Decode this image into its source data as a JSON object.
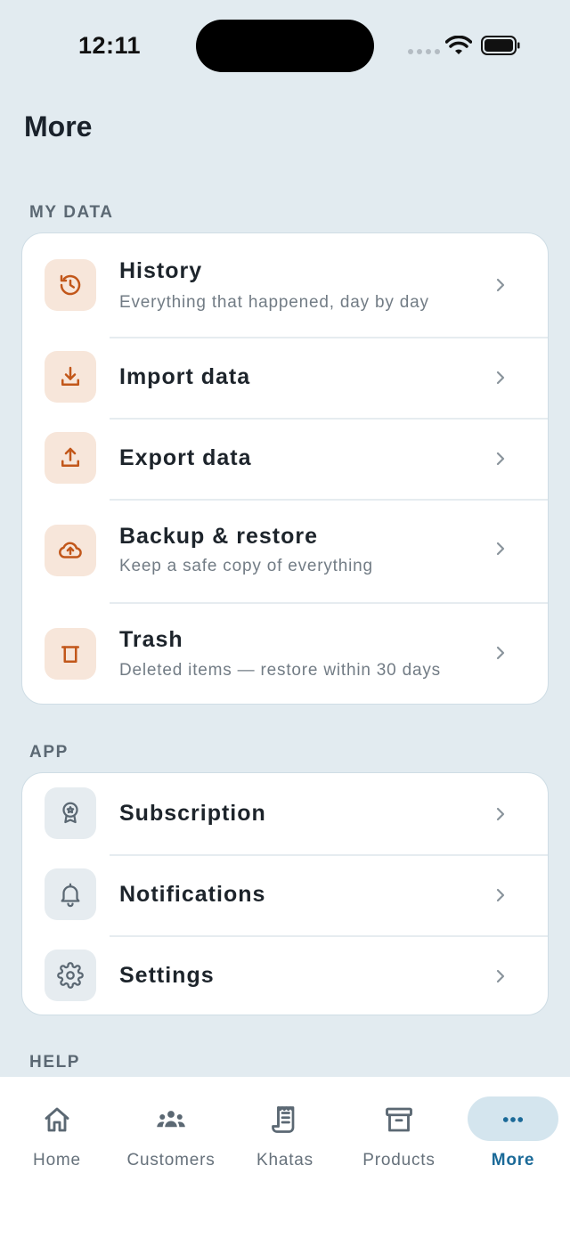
{
  "status": {
    "time": "12:11"
  },
  "page": {
    "title": "More"
  },
  "sections": [
    {
      "label": "MY DATA",
      "items": [
        {
          "title": "History",
          "subtitle": "Everything that happened, day by day",
          "icon": "history-icon"
        },
        {
          "title": "Import data",
          "icon": "download-icon"
        },
        {
          "title": "Export data",
          "icon": "upload-icon"
        },
        {
          "title": "Backup & restore",
          "subtitle": "Keep a safe copy of everything",
          "icon": "cloud-upload-icon"
        },
        {
          "title": "Trash",
          "subtitle": "Deleted items — restore within 30 days",
          "icon": "trash-icon"
        }
      ]
    },
    {
      "label": "APP",
      "items": [
        {
          "title": "Subscription",
          "icon": "award-badge-icon"
        },
        {
          "title": "Notifications",
          "icon": "bell-icon"
        },
        {
          "title": "Settings",
          "icon": "gear-icon"
        }
      ]
    },
    {
      "label": "HELP"
    }
  ],
  "tabs": [
    {
      "label": "Home",
      "icon": "home-icon"
    },
    {
      "label": "Customers",
      "icon": "users-icon"
    },
    {
      "label": "Khatas",
      "icon": "ledger-icon"
    },
    {
      "label": "Products",
      "icon": "archive-box-icon"
    },
    {
      "label": "More",
      "icon": "more-dots-icon",
      "active": true
    }
  ],
  "colors": {
    "background": "#e2ebf0",
    "accent_orange": "#c2571a",
    "active_tab": "#1b6a98",
    "icon_gray": "#5b6873"
  }
}
